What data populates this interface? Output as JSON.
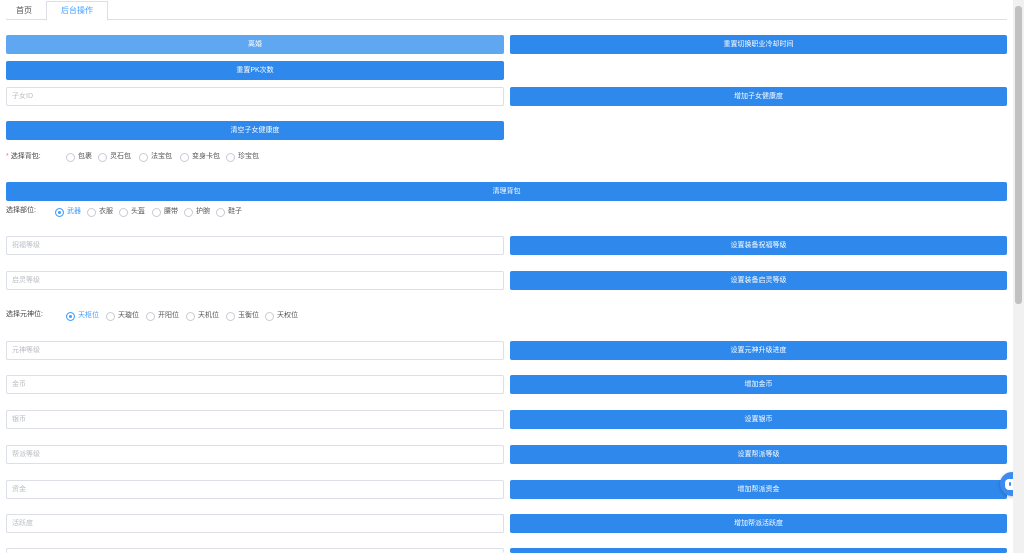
{
  "tabs": [
    {
      "label": "首页"
    },
    {
      "label": "后台操作"
    }
  ],
  "buttons": {
    "top_left": "离婚",
    "top_right": "重置切换职业冷却时间",
    "reset_pk": "重置PK次数",
    "add_child_affection": "增加子女健康度",
    "clear_child_affection": "清空子女健康度",
    "clear_bag": "清理背包",
    "set_bless_level": "设置装备祝福等级",
    "set_awaken_level": "设置装备启灵等级",
    "set_spirit_progress": "设置元神升级进度",
    "add_gold": "增加金币",
    "set_bound_gold": "设置银币",
    "set_faction_level": "设置帮派等级",
    "add_faction_funds": "增加帮派资金",
    "add_faction_activity": "增加帮派活跃度"
  },
  "inputs": {
    "child_id": "子女ID",
    "bless_level": "祝福等级",
    "awaken_level": "启灵等级",
    "spirit_level": "元神等级",
    "gold": "金币",
    "bound_gold": "银币",
    "faction_level": "帮派等级",
    "funds": "资金",
    "activity": "活跃度"
  },
  "bag": {
    "label": "选择背包:",
    "options": [
      "包裹",
      "灵石包",
      "法宝包",
      "变身卡包",
      "珍宝包"
    ]
  },
  "part": {
    "label": "选择部位:",
    "options": [
      "武器",
      "衣服",
      "头盔",
      "腰带",
      "护腕",
      "鞋子"
    ],
    "selected": "武器"
  },
  "spirit": {
    "label": "选择元神位:",
    "options": [
      "天枢位",
      "天璇位",
      "开阳位",
      "天机位",
      "玉衡位",
      "天权位"
    ],
    "selected": "天枢位"
  },
  "colors": {
    "primary": "#2f89ec",
    "primary_light": "#5fa7f1",
    "tab_active": "#409eff"
  }
}
